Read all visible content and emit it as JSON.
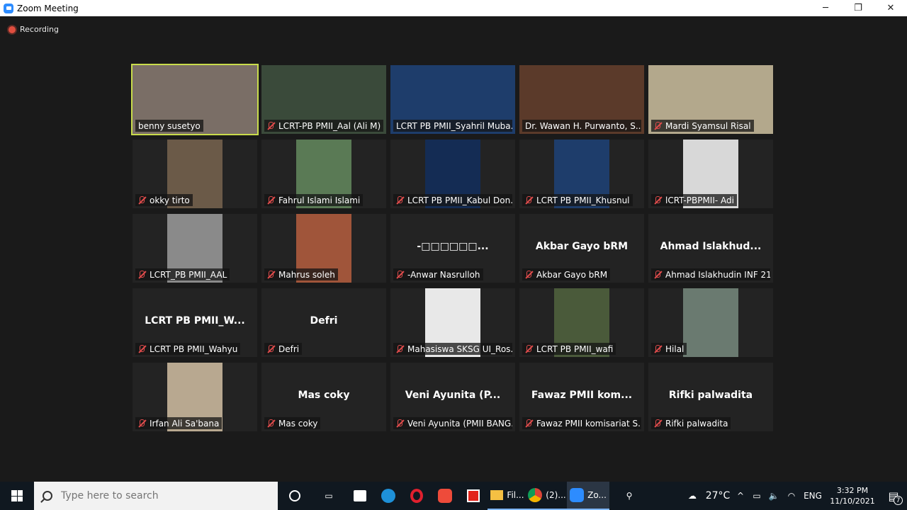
{
  "window": {
    "title": "Zoom Meeting",
    "minimize": "─",
    "maximize": "❐",
    "close": "✕"
  },
  "recording": {
    "label": "Recording"
  },
  "tiles": [
    {
      "name": "benny susetyo",
      "video": true,
      "active": true,
      "muted": false,
      "bg": "#7a6e66"
    },
    {
      "name": "LCRT-PB PMII_Aal (Ali M)",
      "video": true,
      "muted": true,
      "bg": "#3a4a3a"
    },
    {
      "name": "LCRT PB PMII_Syahril Muba...",
      "video": true,
      "muted": false,
      "bg": "#1e3d6b"
    },
    {
      "name": "Dr. Wawan H. Purwanto, S....",
      "video": true,
      "muted": false,
      "bg": "#5b3a2a"
    },
    {
      "name": "Mardi Syamsul Risal",
      "video": true,
      "muted": true,
      "bg": "#b3a88c"
    },
    {
      "name": "okky tirto",
      "video": true,
      "muted": true,
      "bg": "#6b5a48"
    },
    {
      "name": "Fahrul Islami Islami",
      "video": true,
      "muted": true,
      "bg": "#5a7a55"
    },
    {
      "name": "LCRT PB PMII_Kabul Don...",
      "video": true,
      "muted": true,
      "bg": "#142c54"
    },
    {
      "name": "LCRT PB PMII_Khusnul",
      "video": true,
      "muted": true,
      "bg": "#1e3d6b"
    },
    {
      "name": "lCRT-PBPMII- Adi",
      "video": true,
      "muted": true,
      "bg": "#d8d8d8"
    },
    {
      "name": "LCRT_PB PMII_AAL",
      "video": true,
      "muted": true,
      "bg": "#8a8a8a"
    },
    {
      "name": "Mahrus soleh",
      "video": true,
      "muted": true,
      "bg": "#a0553a"
    },
    {
      "name": "-Anwar Nasrulloh",
      "display": "-□□□□□□...",
      "video": false,
      "muted": true
    },
    {
      "name": "Akbar Gayo bRM",
      "display": "Akbar Gayo bRM",
      "video": false,
      "muted": true
    },
    {
      "name": "Ahmad Islakhudin INF 21",
      "display": "Ahmad  Islakhud...",
      "video": false,
      "muted": true
    },
    {
      "name": "LCRT PB PMII_Wahyu",
      "display": "LCRT  PB  PMII_W...",
      "video": false,
      "muted": true
    },
    {
      "name": "Defri",
      "display": "Defri",
      "video": false,
      "muted": true
    },
    {
      "name": "Mahasiswa SKSG UI_Ros...",
      "video": true,
      "muted": true,
      "bg": "#e8e8e8"
    },
    {
      "name": "LCRT PB PMII_wafi",
      "video": true,
      "muted": true,
      "bg": "#4a5a3a"
    },
    {
      "name": "Hilal",
      "video": true,
      "muted": true,
      "bg": "#6a7a70"
    },
    {
      "name": "Irfan Ali Sa'bana",
      "video": true,
      "muted": true,
      "bg": "#b8a890"
    },
    {
      "name": "Mas coky",
      "display": "Mas coky",
      "video": false,
      "muted": true
    },
    {
      "name": "Veni Ayunita (PMII BANG...",
      "display": "Veni  Ayunita  (P...",
      "video": false,
      "muted": true
    },
    {
      "name": "Fawaz PMII komisariat S...",
      "display": "Fawaz  PMII  kom...",
      "video": false,
      "muted": true
    },
    {
      "name": "Rifki palwadita",
      "display": "Rifki palwadita",
      "video": false,
      "muted": true
    }
  ],
  "taskbar": {
    "search_placeholder": "Type here to search",
    "file_explorer_label": "Fil...",
    "chrome_label": "(2)...",
    "zoom_label": "Zo...",
    "weather": "27°C",
    "language": "ENG",
    "time": "3:32 PM",
    "date": "11/10/2021",
    "notifications": "7"
  }
}
